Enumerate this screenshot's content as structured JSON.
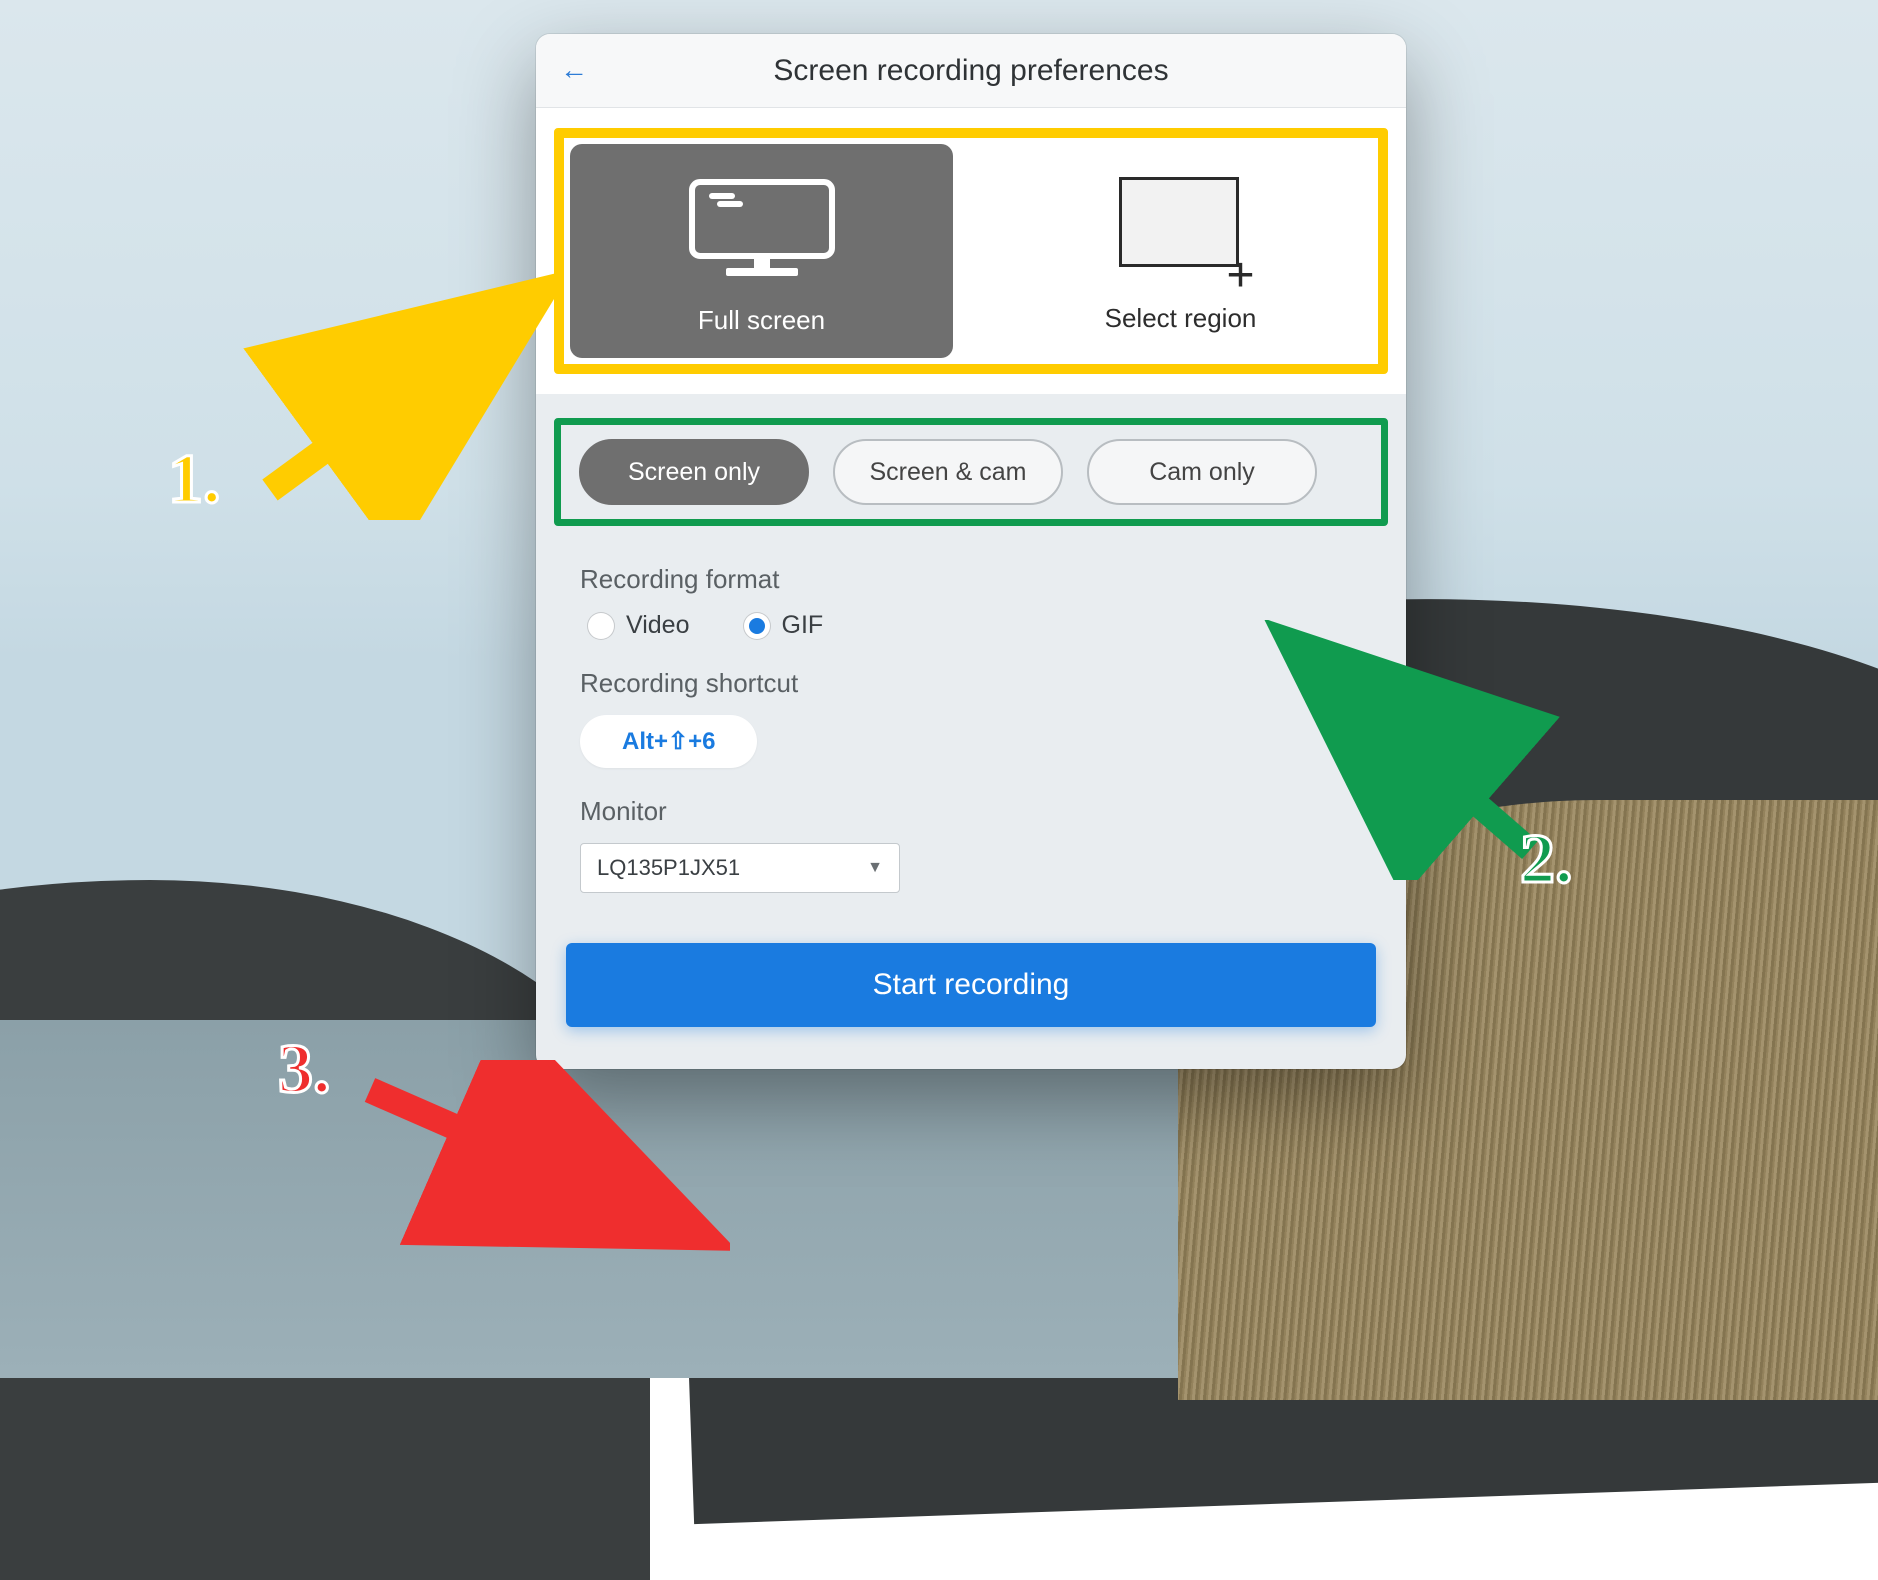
{
  "header": {
    "title": "Screen recording preferences"
  },
  "capture": {
    "full_screen_label": "Full screen",
    "select_region_label": "Select region"
  },
  "source_pills": {
    "screen_only": "Screen only",
    "screen_and_cam": "Screen & cam",
    "cam_only": "Cam only"
  },
  "format": {
    "section_label": "Recording format",
    "video_label": "Video",
    "gif_label": "GIF",
    "selected": "GIF"
  },
  "shortcut": {
    "section_label": "Recording shortcut",
    "value": "Alt+⇧+6"
  },
  "monitor": {
    "section_label": "Monitor",
    "selected": "LQ135P1JX51"
  },
  "actions": {
    "start_label": "Start recording"
  },
  "annotations": {
    "n1": "1.",
    "n2": "2.",
    "n3": "3."
  },
  "colors": {
    "accent_blue": "#1a7be0",
    "highlight_yellow": "#ffcc00",
    "highlight_green": "#109b4f",
    "highlight_red": "#ef2e2e"
  }
}
